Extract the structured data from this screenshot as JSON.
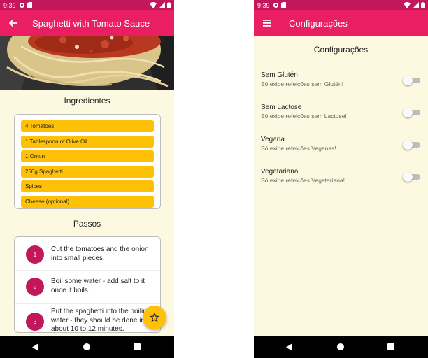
{
  "left_screen": {
    "status": {
      "time": "9:39"
    },
    "appbar": {
      "title": "Spaghetti with Tomato Sauce",
      "back_icon": "arrow-back-icon"
    },
    "hero": {
      "icon": "spaghetti-photo"
    },
    "ingredients": {
      "title": "Ingredientes",
      "items": [
        "4 Tomatoes",
        "1 Tablespoon of Olive Oil",
        "1 Onion",
        "250g Spaghetti",
        "Spices",
        "Cheese (optional)"
      ]
    },
    "steps": {
      "title": "Passos",
      "items": [
        {
          "number": "1",
          "text": "Cut the tomatoes and the onion into small pieces."
        },
        {
          "number": "2",
          "text": "Boil some water - add salt to it once it boils."
        },
        {
          "number": "3",
          "text": "Put the spaghetti into the boiling water - they should be done in about 10 to 12 minutes."
        }
      ]
    },
    "fab": {
      "icon": "star-outline-icon"
    }
  },
  "right_screen": {
    "status": {
      "time": "9:39"
    },
    "appbar": {
      "title": "Configurações",
      "menu_icon": "hamburger-menu-icon"
    },
    "heading": "Configurações",
    "filters": [
      {
        "name": "Sem Glutén",
        "description": "Só exibe refeições sem Glutén!",
        "enabled": false
      },
      {
        "name": "Sem Lactose",
        "description": "Só exibe refeições sem Lactose!",
        "enabled": false
      },
      {
        "name": "Vegana",
        "description": "Só exibe refeições Veganas!",
        "enabled": false
      },
      {
        "name": "Vegetariana",
        "description": "Só exibe refeições Vegetariana!",
        "enabled": false
      }
    ]
  },
  "colors": {
    "primary": "#e91e63",
    "primary_dark": "#c2185b",
    "accent": "#ffc107",
    "background": "#fdf9e1"
  }
}
